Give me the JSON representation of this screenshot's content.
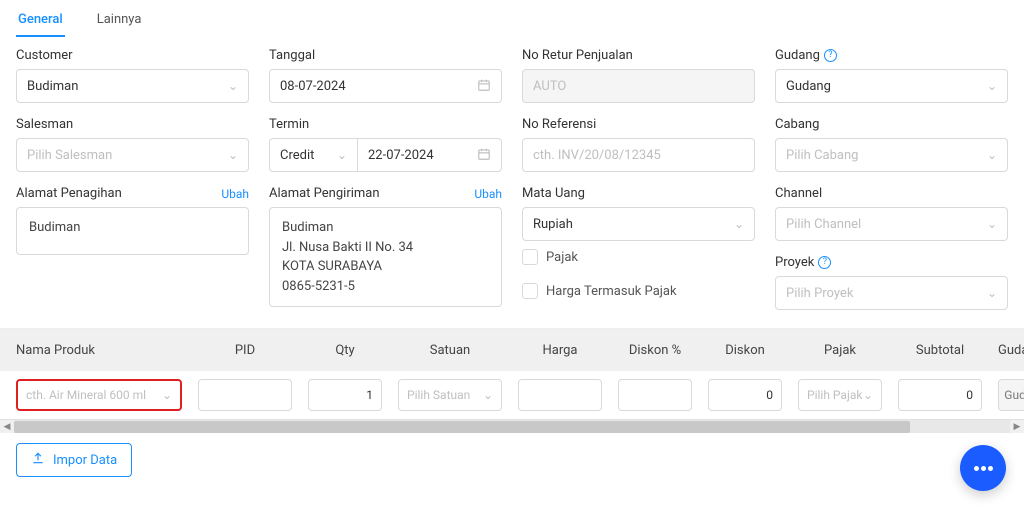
{
  "tabs": {
    "general": "General",
    "lainnya": "Lainnya"
  },
  "labels": {
    "customer": "Customer",
    "tanggal": "Tanggal",
    "no_retur": "No Retur Penjualan",
    "gudang": "Gudang",
    "salesman": "Salesman",
    "termin": "Termin",
    "no_ref": "No Referensi",
    "cabang": "Cabang",
    "alamat_penagihan": "Alamat Penagihan",
    "alamat_pengiriman": "Alamat Pengiriman",
    "mata_uang": "Mata Uang",
    "channel": "Channel",
    "pajak": "Pajak",
    "harga_termasuk_pajak": "Harga Termasuk Pajak",
    "proyek": "Proyek",
    "ubah": "Ubah"
  },
  "values": {
    "customer": "Budiman",
    "tanggal": "08-07-2024",
    "no_retur": "AUTO",
    "gudang": "Gudang",
    "salesman_ph": "Pilih Salesman",
    "termin": "Credit",
    "termin_date": "22-07-2024",
    "no_ref_ph": "cth. INV/20/08/12345",
    "cabang_ph": "Pilih Cabang",
    "mata_uang": "Rupiah",
    "channel_ph": "Pilih Channel",
    "proyek_ph": "Pilih Proyek",
    "billing_addr": "Budiman",
    "ship_name": "Budiman",
    "ship_street": "Jl. Nusa Bakti II No. 34",
    "ship_city": "KOTA SURABAYA",
    "ship_phone": "0865-5231-5"
  },
  "table": {
    "headers": {
      "produk": "Nama Produk",
      "pid": "PID",
      "qty": "Qty",
      "satuan": "Satuan",
      "harga": "Harga",
      "diskonp": "Diskon %",
      "diskon": "Diskon",
      "pajak": "Pajak",
      "subtotal": "Subtotal",
      "gudang": "Guda"
    },
    "row": {
      "produk_ph": "cth. Air Mineral 600 ml",
      "pid": "",
      "qty": "1",
      "satuan_ph": "Pilih Satuan",
      "harga": "",
      "diskonp": "",
      "diskon": "0",
      "pajak_ph": "Pilih Pajak",
      "subtotal": "0",
      "gudang": "Gudang"
    }
  },
  "footer": {
    "impor": "Impor Data"
  },
  "icons": {
    "help": "?",
    "chev": "⌄",
    "calendar": "📅",
    "upload": "↥",
    "left": "◀",
    "right": "▶"
  }
}
